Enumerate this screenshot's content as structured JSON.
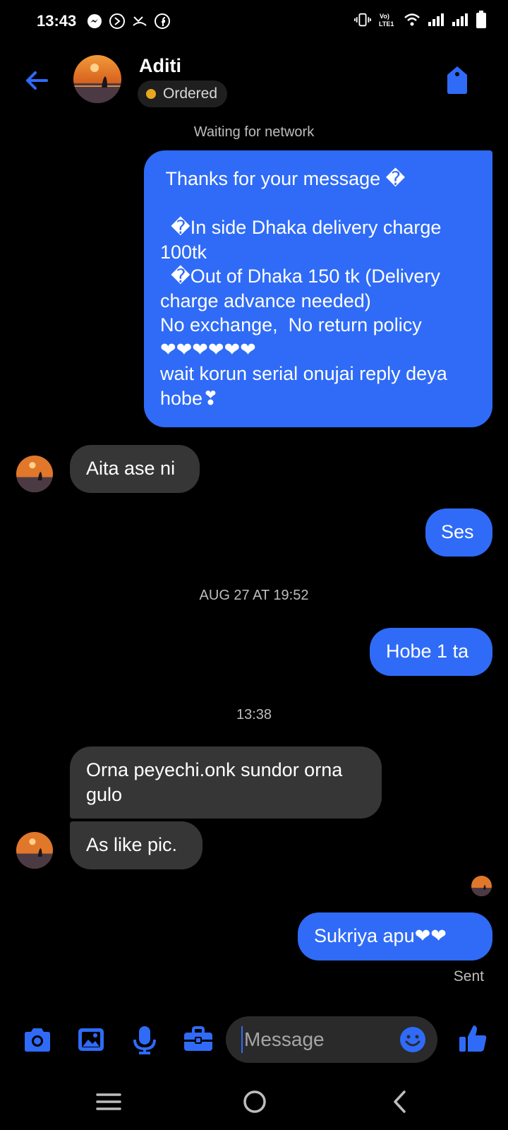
{
  "status_bar": {
    "time": "13:43",
    "left_icons": [
      "messenger-icon",
      "play-circle-icon",
      "missed-call-icon",
      "facebook-icon"
    ],
    "right_icons": [
      "vibrate-icon",
      "volte-icon",
      "wifi-icon",
      "signal-icon",
      "signal-icon",
      "battery-icon"
    ],
    "volte_label": "Vo) LTE1"
  },
  "header": {
    "contact_name": "Aditi",
    "label": "Ordered",
    "label_color": "#e7a81f",
    "back_icon": "back-arrow-icon",
    "tag_icon": "tag-icon"
  },
  "network_status": "Waiting for network",
  "messages": [
    {
      "from": "me",
      "text": " Thanks for your message �\n\n  �In side Dhaka delivery charge 100tk\n  �Out of Dhaka 150 tk (Delivery charge advance needed)\nNo exchange,  No return policy\n❤❤❤❤❤❤\nwait korun serial onujai reply deya hobe❣"
    },
    {
      "from": "them",
      "text": "Aita ase ni"
    },
    {
      "from": "me",
      "text": "Ses"
    },
    {
      "from": "me",
      "text": "Hobe 1 ta"
    },
    {
      "from": "them",
      "text": "Orna peyechi.onk sundor orna gulo"
    },
    {
      "from": "them",
      "text": "As like pic."
    },
    {
      "from": "me",
      "text": "Sukriya apu❤❤"
    }
  ],
  "timestamps": [
    "AUG 27 AT 19:52",
    "13:38"
  ],
  "delivery_status": "Sent",
  "composer": {
    "placeholder": "Message",
    "icons": [
      "camera-icon",
      "gallery-icon",
      "microphone-icon",
      "briefcase-icon",
      "emoji-icon",
      "thumbs-up-icon"
    ]
  },
  "nav_bar": {
    "icons": [
      "menu-icon",
      "home-icon",
      "back-icon"
    ]
  },
  "colors": {
    "accent": "#2f6bf7",
    "incoming_bubble": "#363636",
    "background": "#000000"
  }
}
